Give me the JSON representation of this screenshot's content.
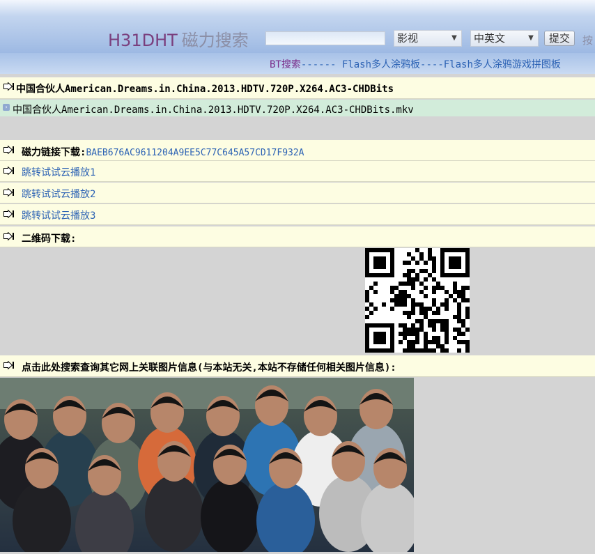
{
  "header": {
    "logo_text": "H31DHT",
    "logo_cn": "磁力搜索",
    "search_placeholder": "",
    "category_select": "影视",
    "language_select": "中英文",
    "submit_label": "提交",
    "trailing_text": "按"
  },
  "nav": {
    "bt_search": "BT搜索",
    "sep1": "------ ",
    "link1": "Flash多人涂鸦板",
    "sep2": "----",
    "link2": "Flash多人涂鸦游戏拼图板"
  },
  "torrent": {
    "title": "中国合伙人American.Dreams.in.China.2013.HDTV.720P.X264.AC3-CHDBits",
    "file": "中国合伙人American.Dreams.in.China.2013.HDTV.720P.X264.AC3-CHDBits.mkv"
  },
  "magnet": {
    "label": "磁力链接下载:",
    "hash": "BAEB676AC9611204A9EE5C77C645A57CD17F932A"
  },
  "play_links": [
    "跳转试试云播放1",
    "跳转试试云播放2",
    "跳转试试云播放3"
  ],
  "qr_label": "二维码下载:",
  "image_search_label": "点击此处搜索查询其它网上关联图片信息(与本站无关,本站不存储任何相关图片信息):",
  "colors": {
    "cream_row": "#fdfde2",
    "file_row": "#d2ecda",
    "link": "#2c62b4",
    "logo": "#7a3f7e",
    "background": "#d4d4d4"
  }
}
